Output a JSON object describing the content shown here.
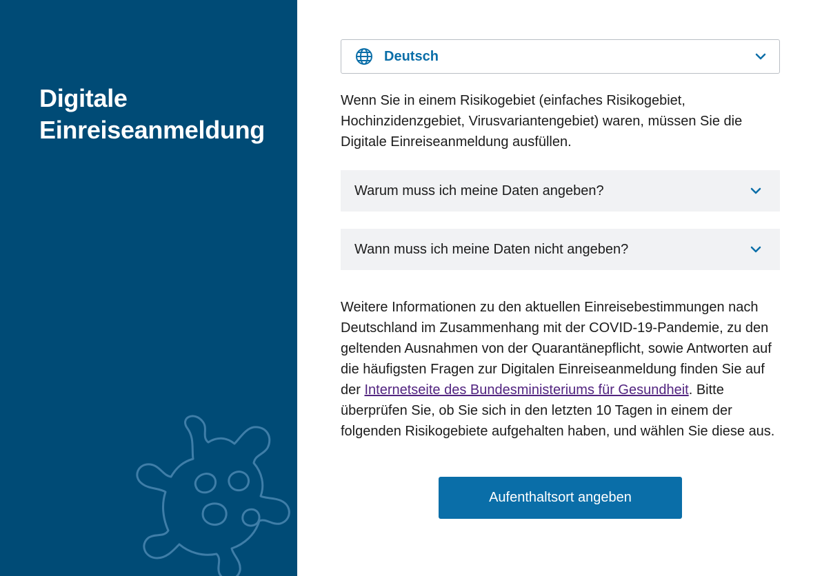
{
  "sidebar": {
    "title_line1": "Digitale",
    "title_line2": "Einreiseanmeldung",
    "background": "#004b76"
  },
  "language": {
    "selected": "Deutsch",
    "icon": "globe-icon"
  },
  "intro_text": "Wenn Sie in einem Risikogebiet (einfaches Risikogebiet, Hochinzidenzgebiet, Virusvariantengebiet) waren, müssen Sie die Digitale Einreiseanmeldung ausfüllen.",
  "accordions": [
    {
      "label": "Warum muss ich meine Daten angeben?"
    },
    {
      "label": "Wann muss ich meine Daten nicht angeben?"
    }
  ],
  "info": {
    "before_link": "Weitere Informationen zu den aktuellen Einreisebestimmungen nach Deutschland im Zusammenhang mit der COVID-19-Pandemie, zu den geltenden Ausnahmen von der Quarantänepflicht, sowie Antworten auf die häufigsten Fragen zur Digitalen Einreiseanmeldung finden Sie auf der ",
    "link_text": "Internetseite des Bundesministeriums für Gesundheit",
    "after_link": ". Bitte überprüfen Sie, ob Sie sich in den letzten 10 Tagen in einem der folgenden Risikogebiete aufgehalten haben, und wählen Sie diese aus."
  },
  "cta_label": "Aufenthaltsort angeben",
  "colors": {
    "accent": "#0a6ea8",
    "link": "#51237f",
    "accordion_bg": "#f1f2f4"
  }
}
